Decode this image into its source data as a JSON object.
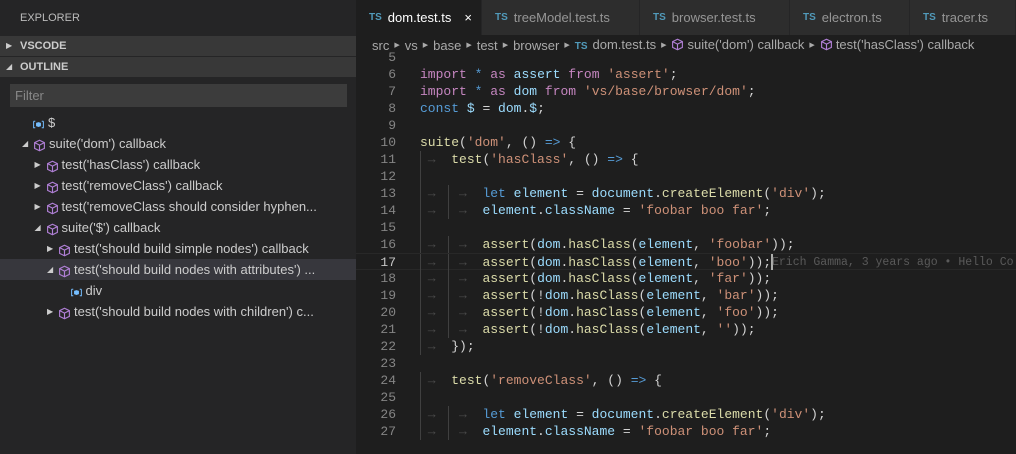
{
  "sidebar": {
    "title": "EXPLORER",
    "sections": [
      {
        "label": "VSCODE",
        "expanded": false
      },
      {
        "label": "OUTLINE",
        "expanded": true
      }
    ],
    "filter_placeholder": "Filter",
    "outline": [
      {
        "label": "$",
        "icon": "variable-icon",
        "level": 0,
        "twisty": "none"
      },
      {
        "label": "suite('dom') callback",
        "icon": "module-icon",
        "level": 0,
        "twisty": "expanded"
      },
      {
        "label": "test('hasClass') callback",
        "icon": "module-icon",
        "level": 1,
        "twisty": "collapsed"
      },
      {
        "label": "test('removeClass') callback",
        "icon": "module-icon",
        "level": 1,
        "twisty": "collapsed"
      },
      {
        "label": "test('removeClass should consider hyphen...",
        "icon": "module-icon",
        "level": 1,
        "twisty": "collapsed"
      },
      {
        "label": "suite('$') callback",
        "icon": "module-icon",
        "level": 1,
        "twisty": "expanded"
      },
      {
        "label": "test('should build simple nodes') callback",
        "icon": "module-icon",
        "level": 2,
        "twisty": "collapsed"
      },
      {
        "label": "test('should build nodes with attributes') ...",
        "icon": "module-icon",
        "level": 2,
        "twisty": "expanded",
        "selected": true
      },
      {
        "label": "div",
        "icon": "variable-icon",
        "level": 3,
        "twisty": "none"
      },
      {
        "label": "test('should build nodes with children') c...",
        "icon": "module-icon",
        "level": 2,
        "twisty": "collapsed"
      }
    ]
  },
  "tabs": [
    {
      "label": "dom.test.ts",
      "active": true,
      "close": "×"
    },
    {
      "label": "treeModel.test.ts"
    },
    {
      "label": "browser.test.ts"
    },
    {
      "label": "electron.ts"
    },
    {
      "label": "tracer.ts"
    }
  ],
  "tab_badge": "TS",
  "breadcrumb": [
    "src",
    "vs",
    "base",
    "test",
    "browser",
    "dom.test.ts",
    "suite('dom') callback",
    "test('hasClass') callback"
  ],
  "blame": "Erich Gamma, 3 years ago • Hello Co",
  "current_line": 17,
  "colors": {
    "keyword": "#c586c0",
    "storage": "#569cd6",
    "variable": "#9cdcfe",
    "string": "#ce9178",
    "function": "#dcdcaa"
  },
  "code": [
    {
      "n": 5,
      "i": 0,
      "t": []
    },
    {
      "n": 6,
      "i": 0,
      "t": [
        [
          "import",
          "k"
        ],
        [
          " ",
          "p"
        ],
        [
          "*",
          "b"
        ],
        [
          " ",
          "p"
        ],
        [
          "as",
          "k"
        ],
        [
          " ",
          "p"
        ],
        [
          "assert",
          "v"
        ],
        [
          " ",
          "p"
        ],
        [
          "from",
          "k"
        ],
        [
          " ",
          "p"
        ],
        [
          "'assert'",
          "s"
        ],
        [
          ";",
          "p"
        ]
      ]
    },
    {
      "n": 7,
      "i": 0,
      "t": [
        [
          "import",
          "k"
        ],
        [
          " ",
          "p"
        ],
        [
          "*",
          "b"
        ],
        [
          " ",
          "p"
        ],
        [
          "as",
          "k"
        ],
        [
          " ",
          "p"
        ],
        [
          "dom",
          "v"
        ],
        [
          " ",
          "p"
        ],
        [
          "from",
          "k"
        ],
        [
          " ",
          "p"
        ],
        [
          "'vs/base/browser/dom'",
          "s"
        ],
        [
          ";",
          "p"
        ]
      ]
    },
    {
      "n": 8,
      "i": 0,
      "t": [
        [
          "const",
          "b"
        ],
        [
          " ",
          "p"
        ],
        [
          "$",
          "v"
        ],
        [
          " = ",
          "p"
        ],
        [
          "dom",
          "v"
        ],
        [
          ".",
          "p"
        ],
        [
          "$",
          "v"
        ],
        [
          ";",
          "p"
        ]
      ]
    },
    {
      "n": 9,
      "i": 0,
      "t": []
    },
    {
      "n": 10,
      "i": 0,
      "t": [
        [
          "suite",
          "f"
        ],
        [
          "(",
          "p"
        ],
        [
          "'dom'",
          "s"
        ],
        [
          ", () ",
          "p"
        ],
        [
          "=>",
          "b"
        ],
        [
          " {",
          "p"
        ]
      ]
    },
    {
      "n": 11,
      "i": 1,
      "t": [
        [
          "test",
          "f"
        ],
        [
          "(",
          "p"
        ],
        [
          "'hasClass'",
          "s"
        ],
        [
          ", () ",
          "p"
        ],
        [
          "=>",
          "b"
        ],
        [
          " {",
          "p"
        ]
      ]
    },
    {
      "n": 12,
      "i": 1,
      "t": []
    },
    {
      "n": 13,
      "i": 2,
      "t": [
        [
          "let",
          "b"
        ],
        [
          " ",
          "p"
        ],
        [
          "element",
          "v"
        ],
        [
          " = ",
          "p"
        ],
        [
          "document",
          "v"
        ],
        [
          ".",
          "p"
        ],
        [
          "createElement",
          "f"
        ],
        [
          "(",
          "p"
        ],
        [
          "'div'",
          "s"
        ],
        [
          ");",
          "p"
        ]
      ]
    },
    {
      "n": 14,
      "i": 2,
      "t": [
        [
          "element",
          "v"
        ],
        [
          ".",
          "p"
        ],
        [
          "className",
          "v"
        ],
        [
          " = ",
          "p"
        ],
        [
          "'foobar boo far'",
          "s"
        ],
        [
          ";",
          "p"
        ]
      ]
    },
    {
      "n": 15,
      "i": 1,
      "t": []
    },
    {
      "n": 16,
      "i": 2,
      "t": [
        [
          "assert",
          "f"
        ],
        [
          "(",
          "p"
        ],
        [
          "dom",
          "v"
        ],
        [
          ".",
          "p"
        ],
        [
          "hasClass",
          "f"
        ],
        [
          "(",
          "p"
        ],
        [
          "element",
          "v"
        ],
        [
          ", ",
          "p"
        ],
        [
          "'foobar'",
          "s"
        ],
        [
          "));",
          "p"
        ]
      ]
    },
    {
      "n": 17,
      "i": 2,
      "t": [
        [
          "assert",
          "f"
        ],
        [
          "(",
          "p"
        ],
        [
          "dom",
          "v"
        ],
        [
          ".",
          "p"
        ],
        [
          "hasClass",
          "f"
        ],
        [
          "(",
          "p"
        ],
        [
          "element",
          "v"
        ],
        [
          ", ",
          "p"
        ],
        [
          "'boo'",
          "s"
        ],
        [
          "));",
          "p"
        ]
      ]
    },
    {
      "n": 18,
      "i": 2,
      "t": [
        [
          "assert",
          "f"
        ],
        [
          "(",
          "p"
        ],
        [
          "dom",
          "v"
        ],
        [
          ".",
          "p"
        ],
        [
          "hasClass",
          "f"
        ],
        [
          "(",
          "p"
        ],
        [
          "element",
          "v"
        ],
        [
          ", ",
          "p"
        ],
        [
          "'far'",
          "s"
        ],
        [
          "));",
          "p"
        ]
      ]
    },
    {
      "n": 19,
      "i": 2,
      "t": [
        [
          "assert",
          "f"
        ],
        [
          "(!",
          "p"
        ],
        [
          "dom",
          "v"
        ],
        [
          ".",
          "p"
        ],
        [
          "hasClass",
          "f"
        ],
        [
          "(",
          "p"
        ],
        [
          "element",
          "v"
        ],
        [
          ", ",
          "p"
        ],
        [
          "'bar'",
          "s"
        ],
        [
          "));",
          "p"
        ]
      ]
    },
    {
      "n": 20,
      "i": 2,
      "t": [
        [
          "assert",
          "f"
        ],
        [
          "(!",
          "p"
        ],
        [
          "dom",
          "v"
        ],
        [
          ".",
          "p"
        ],
        [
          "hasClass",
          "f"
        ],
        [
          "(",
          "p"
        ],
        [
          "element",
          "v"
        ],
        [
          ", ",
          "p"
        ],
        [
          "'foo'",
          "s"
        ],
        [
          "));",
          "p"
        ]
      ]
    },
    {
      "n": 21,
      "i": 2,
      "t": [
        [
          "assert",
          "f"
        ],
        [
          "(!",
          "p"
        ],
        [
          "dom",
          "v"
        ],
        [
          ".",
          "p"
        ],
        [
          "hasClass",
          "f"
        ],
        [
          "(",
          "p"
        ],
        [
          "element",
          "v"
        ],
        [
          ", ",
          "p"
        ],
        [
          "''",
          "s"
        ],
        [
          "));",
          "p"
        ]
      ]
    },
    {
      "n": 22,
      "i": 1,
      "t": [
        [
          "});",
          "p"
        ]
      ]
    },
    {
      "n": 23,
      "i": 0,
      "t": []
    },
    {
      "n": 24,
      "i": 1,
      "t": [
        [
          "test",
          "f"
        ],
        [
          "(",
          "p"
        ],
        [
          "'removeClass'",
          "s"
        ],
        [
          ", () ",
          "p"
        ],
        [
          "=>",
          "b"
        ],
        [
          " {",
          "p"
        ]
      ]
    },
    {
      "n": 25,
      "i": 1,
      "t": []
    },
    {
      "n": 26,
      "i": 2,
      "t": [
        [
          "let",
          "b"
        ],
        [
          " ",
          "p"
        ],
        [
          "element",
          "v"
        ],
        [
          " = ",
          "p"
        ],
        [
          "document",
          "v"
        ],
        [
          ".",
          "p"
        ],
        [
          "createElement",
          "f"
        ],
        [
          "(",
          "p"
        ],
        [
          "'div'",
          "s"
        ],
        [
          ");",
          "p"
        ]
      ]
    },
    {
      "n": 27,
      "i": 2,
      "t": [
        [
          "element",
          "v"
        ],
        [
          ".",
          "p"
        ],
        [
          "className",
          "v"
        ],
        [
          " = ",
          "p"
        ],
        [
          "'foobar boo far'",
          "s"
        ],
        [
          ";",
          "p"
        ]
      ]
    }
  ]
}
